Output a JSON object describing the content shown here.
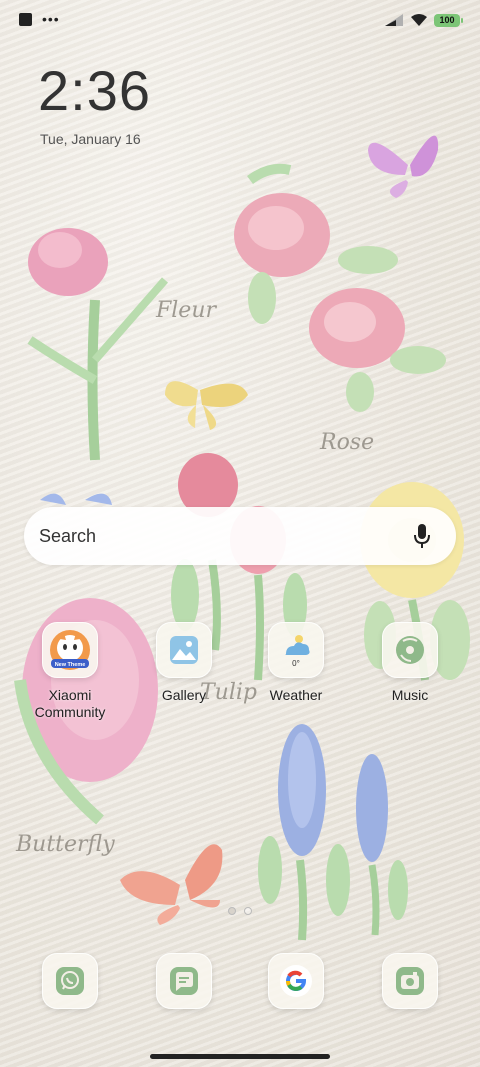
{
  "status_bar": {
    "battery": "100",
    "notification_dots": "•••"
  },
  "lock": {
    "time": "2:36",
    "date": "Tue, January 16"
  },
  "search": {
    "label": "Search"
  },
  "apps": [
    {
      "label": "Xiaomi\nCommunity",
      "icon": "xiaomi-community-icon"
    },
    {
      "label": "Gallery",
      "icon": "gallery-icon"
    },
    {
      "label": "Weather",
      "icon": "weather-icon",
      "temp": "0°"
    },
    {
      "label": "Music",
      "icon": "music-icon"
    }
  ],
  "xiaomi_badge_text": "New Theme",
  "dock": [
    {
      "icon": "whatsapp-icon"
    },
    {
      "icon": "messages-icon"
    },
    {
      "icon": "google-icon"
    },
    {
      "icon": "camera-icon"
    }
  ],
  "wallpaper_text": {
    "fleur": "Fleur",
    "rose": "Rose",
    "tulip": "Tulip",
    "butterfly": "Butterfly"
  },
  "colors": {
    "accent_green": "#7cc576",
    "icon_green": "#8fb98a"
  }
}
